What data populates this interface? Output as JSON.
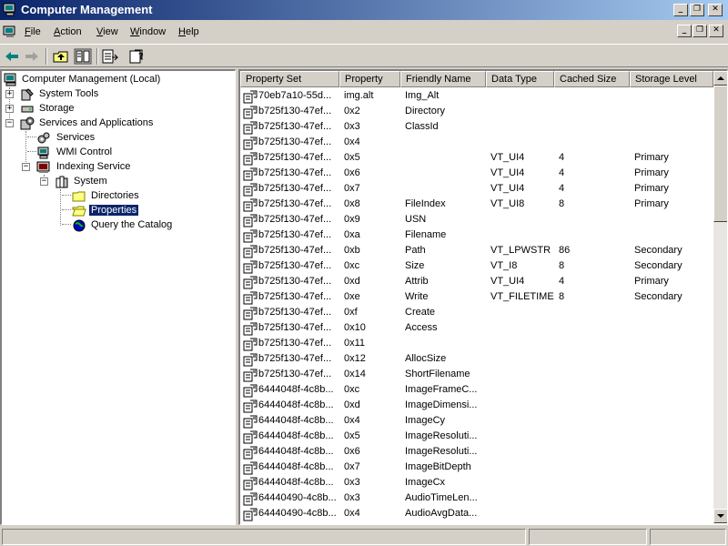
{
  "window": {
    "title": "Computer Management",
    "controls": {
      "minimize": "_",
      "maximize": "❐",
      "close": "✕"
    }
  },
  "menu": {
    "items": [
      {
        "label": "File",
        "accel": "F",
        "rest": "ile"
      },
      {
        "label": "Action",
        "accel": "A",
        "rest": "ction"
      },
      {
        "label": "View",
        "accel": "V",
        "rest": "iew"
      },
      {
        "label": "Window",
        "accel": "W",
        "rest": "indow"
      },
      {
        "label": "Help",
        "accel": "H",
        "rest": "elp"
      }
    ]
  },
  "toolbar": {
    "icons": [
      "back-arrow-icon",
      "forward-arrow-icon",
      "up-one-level-icon",
      "show-hide-tree-icon",
      "export-list-icon",
      "help-icon"
    ]
  },
  "tree": {
    "root": "Computer Management (Local)",
    "system_tools": "System Tools",
    "storage": "Storage",
    "services_apps": "Services and Applications",
    "services": "Services",
    "wmi": "WMI Control",
    "indexing": "Indexing Service",
    "system": "System",
    "directories": "Directories",
    "properties": "Properties",
    "query": "Query the Catalog"
  },
  "table": {
    "columns": [
      "Property Set",
      "Property",
      "Friendly Name",
      "Data Type",
      "Cached Size",
      "Storage Level"
    ],
    "rows": [
      [
        "70eb7a10-55d...",
        "img.alt",
        "Img_Alt",
        "",
        "",
        ""
      ],
      [
        "b725f130-47ef...",
        "0x2",
        "Directory",
        "",
        "",
        ""
      ],
      [
        "b725f130-47ef...",
        "0x3",
        "ClassId",
        "",
        "",
        ""
      ],
      [
        "b725f130-47ef...",
        "0x4",
        "",
        "",
        "",
        ""
      ],
      [
        "b725f130-47ef...",
        "0x5",
        "",
        "VT_UI4",
        "4",
        "Primary"
      ],
      [
        "b725f130-47ef...",
        "0x6",
        "",
        "VT_UI4",
        "4",
        "Primary"
      ],
      [
        "b725f130-47ef...",
        "0x7",
        "",
        "VT_UI4",
        "4",
        "Primary"
      ],
      [
        "b725f130-47ef...",
        "0x8",
        "FileIndex",
        "VT_UI8",
        "8",
        "Primary"
      ],
      [
        "b725f130-47ef...",
        "0x9",
        "USN",
        "",
        "",
        ""
      ],
      [
        "b725f130-47ef...",
        "0xa",
        "Filename",
        "",
        "",
        ""
      ],
      [
        "b725f130-47ef...",
        "0xb",
        "Path",
        "VT_LPWSTR",
        "86",
        "Secondary"
      ],
      [
        "b725f130-47ef...",
        "0xc",
        "Size",
        "VT_I8",
        "8",
        "Secondary"
      ],
      [
        "b725f130-47ef...",
        "0xd",
        "Attrib",
        "VT_UI4",
        "4",
        "Primary"
      ],
      [
        "b725f130-47ef...",
        "0xe",
        "Write",
        "VT_FILETIME",
        "8",
        "Secondary"
      ],
      [
        "b725f130-47ef...",
        "0xf",
        "Create",
        "",
        "",
        ""
      ],
      [
        "b725f130-47ef...",
        "0x10",
        "Access",
        "",
        "",
        ""
      ],
      [
        "b725f130-47ef...",
        "0x11",
        "",
        "",
        "",
        ""
      ],
      [
        "b725f130-47ef...",
        "0x12",
        "AllocSize",
        "",
        "",
        ""
      ],
      [
        "b725f130-47ef...",
        "0x14",
        "ShortFilename",
        "",
        "",
        ""
      ],
      [
        "6444048f-4c8b...",
        "0xc",
        "ImageFrameC...",
        "",
        "",
        ""
      ],
      [
        "6444048f-4c8b...",
        "0xd",
        "ImageDimensi...",
        "",
        "",
        ""
      ],
      [
        "6444048f-4c8b...",
        "0x4",
        "ImageCy",
        "",
        "",
        ""
      ],
      [
        "6444048f-4c8b...",
        "0x5",
        "ImageResoluti...",
        "",
        "",
        ""
      ],
      [
        "6444048f-4c8b...",
        "0x6",
        "ImageResoluti...",
        "",
        "",
        ""
      ],
      [
        "6444048f-4c8b...",
        "0x7",
        "ImageBitDepth",
        "",
        "",
        ""
      ],
      [
        "6444048f-4c8b...",
        "0x3",
        "ImageCx",
        "",
        "",
        ""
      ],
      [
        "64440490-4c8b...",
        "0x3",
        "AudioTimeLen...",
        "",
        "",
        ""
      ],
      [
        "64440490-4c8b...",
        "0x4",
        "AudioAvgData...",
        "",
        "",
        ""
      ]
    ]
  },
  "colors": {
    "title_start": "#0a246a",
    "title_end": "#a6caf0",
    "selection": "#0a246a",
    "face": "#d4d0c8"
  }
}
